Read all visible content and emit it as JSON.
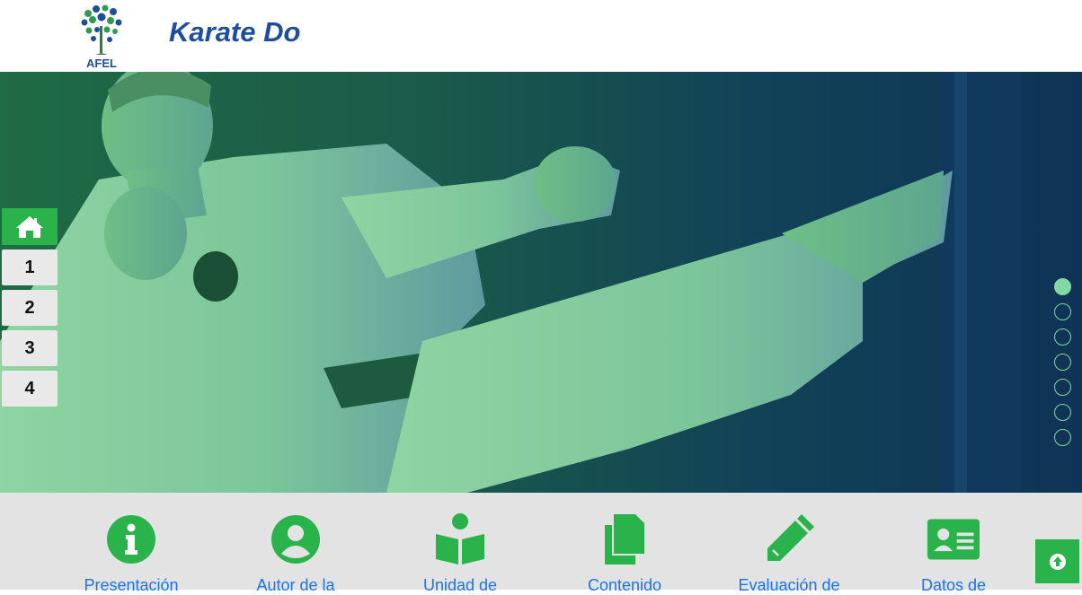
{
  "header": {
    "logo_text": "AFEL",
    "title": "Karate Do"
  },
  "sidebar": {
    "home_icon": "home-icon",
    "items": [
      {
        "label": "1"
      },
      {
        "label": "2"
      },
      {
        "label": "3"
      },
      {
        "label": "4"
      }
    ]
  },
  "slider": {
    "dot_count": 7,
    "active_index": 0
  },
  "menu": {
    "items": [
      {
        "label": "Presentación",
        "icon": "info-circle-icon"
      },
      {
        "label": "Autor de la",
        "icon": "user-circle-icon"
      },
      {
        "label": "Unidad de",
        "icon": "book-reader-icon"
      },
      {
        "label": "Contenido",
        "icon": "copy-icon"
      },
      {
        "label": "Evaluación de",
        "icon": "pencil-icon"
      },
      {
        "label": "Datos de",
        "icon": "id-card-icon"
      }
    ]
  },
  "colors": {
    "brand_green": "#2bb34b",
    "title_blue": "#1d4e9e",
    "link_blue": "#1a73e8",
    "menu_bg": "#e3e3e3"
  },
  "scroll_top_icon": "arrow-up-circle-icon"
}
